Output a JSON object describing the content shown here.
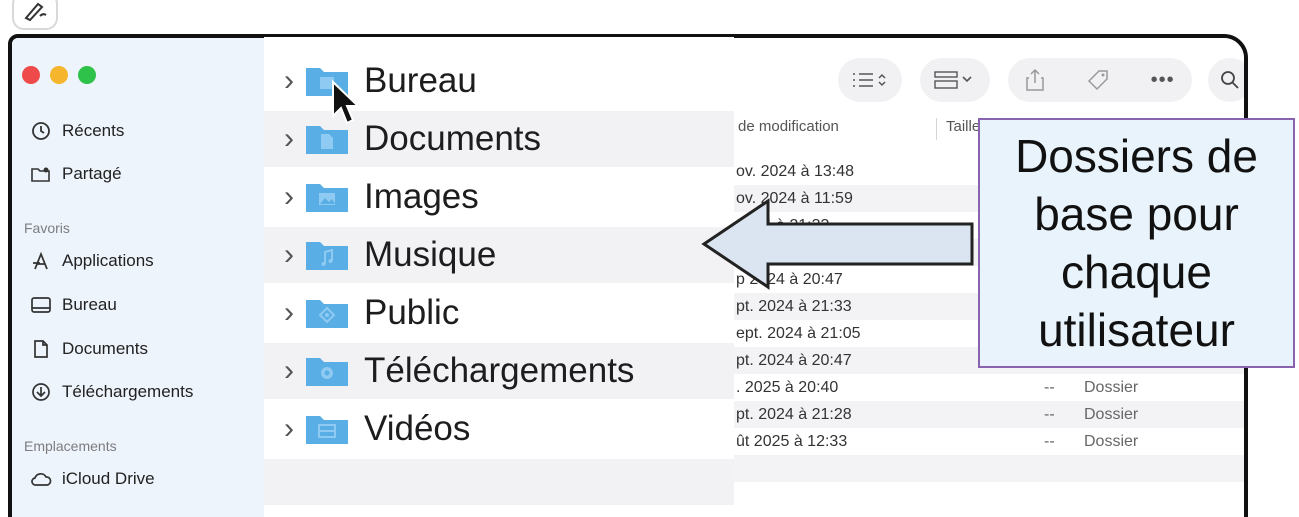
{
  "sidebar": {
    "items_top": [
      {
        "label": "Récents",
        "icon": "clock-icon"
      },
      {
        "label": "Partagé",
        "icon": "shared-folder-icon"
      }
    ],
    "favorites_header": "Favoris",
    "favorites": [
      {
        "label": "Applications",
        "icon": "applications-icon"
      },
      {
        "label": "Bureau",
        "icon": "desktop-icon"
      },
      {
        "label": "Documents",
        "icon": "document-icon"
      },
      {
        "label": "Téléchargements",
        "icon": "download-icon"
      }
    ],
    "locations_header": "Emplacements",
    "locations": [
      {
        "label": "iCloud Drive",
        "icon": "cloud-icon"
      }
    ]
  },
  "columns": {
    "date_modified": "de modification",
    "size": "Taille"
  },
  "dates": [
    "ov. 2024 à 13:48",
    "ov. 2024 à 11:59",
    "2024 à 21:33",
    "",
    "p 2024 à 20:47",
    "pt. 2024 à 21:33",
    "ept. 2024 à 21:05",
    "pt. 2024 à 20:47",
    ". 2025 à 20:40",
    "pt. 2024 à 21:28",
    "ût 2025 à 12:33"
  ],
  "kinds": [
    {
      "size": "--",
      "kind": "Dossier"
    },
    {
      "size": "--",
      "kind": "Dossier"
    },
    {
      "size": "--",
      "kind": "Dossier"
    }
  ],
  "folders": [
    {
      "label": "Bureau",
      "icon": "desktop-folder-icon"
    },
    {
      "label": "Documents",
      "icon": "document-folder-icon"
    },
    {
      "label": "Images",
      "icon": "images-folder-icon"
    },
    {
      "label": "Musique",
      "icon": "music-folder-icon"
    },
    {
      "label": "Public",
      "icon": "public-folder-icon"
    },
    {
      "label": "Téléchargements",
      "icon": "download-folder-icon"
    },
    {
      "label": "Vidéos",
      "icon": "videos-folder-icon"
    }
  ],
  "annotation": {
    "text": "Dossiers de\nbase pour\nchaque\nutilisateur"
  },
  "colors": {
    "folder": "#5aaee6",
    "annotation_border": "#8a63b0",
    "annotation_bg": "#e9f3fb",
    "arrow_fill": "#dbe5f2"
  }
}
